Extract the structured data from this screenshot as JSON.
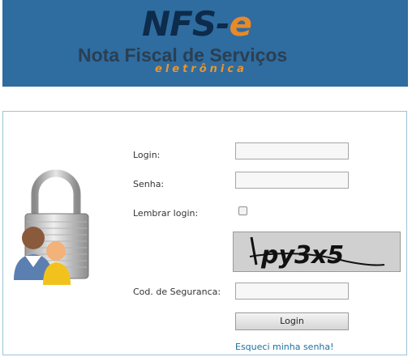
{
  "header": {
    "logo_part1": "NFS-",
    "logo_part2": "e",
    "subtitle": "Nota Fiscal de Serviços",
    "tagline": "eletrônica"
  },
  "form": {
    "login_label": "Login:",
    "password_label": "Senha:",
    "remember_label": "Lembrar login:",
    "security_code_label": "Cod. de Seguranca:",
    "login_value": "",
    "password_value": "",
    "security_code_value": "",
    "remember_checked": false,
    "captcha_text": "py3x5",
    "submit_label": "Login",
    "forgot_link": "Esqueci minha senha!"
  },
  "colors": {
    "banner": "#2f6ca0",
    "logo_dark": "#0d2b4a",
    "logo_accent": "#e8892a",
    "link": "#1b6f9e",
    "panel_border": "#9fc3d9"
  },
  "icons": {
    "lock": "padlock-with-users-icon"
  }
}
